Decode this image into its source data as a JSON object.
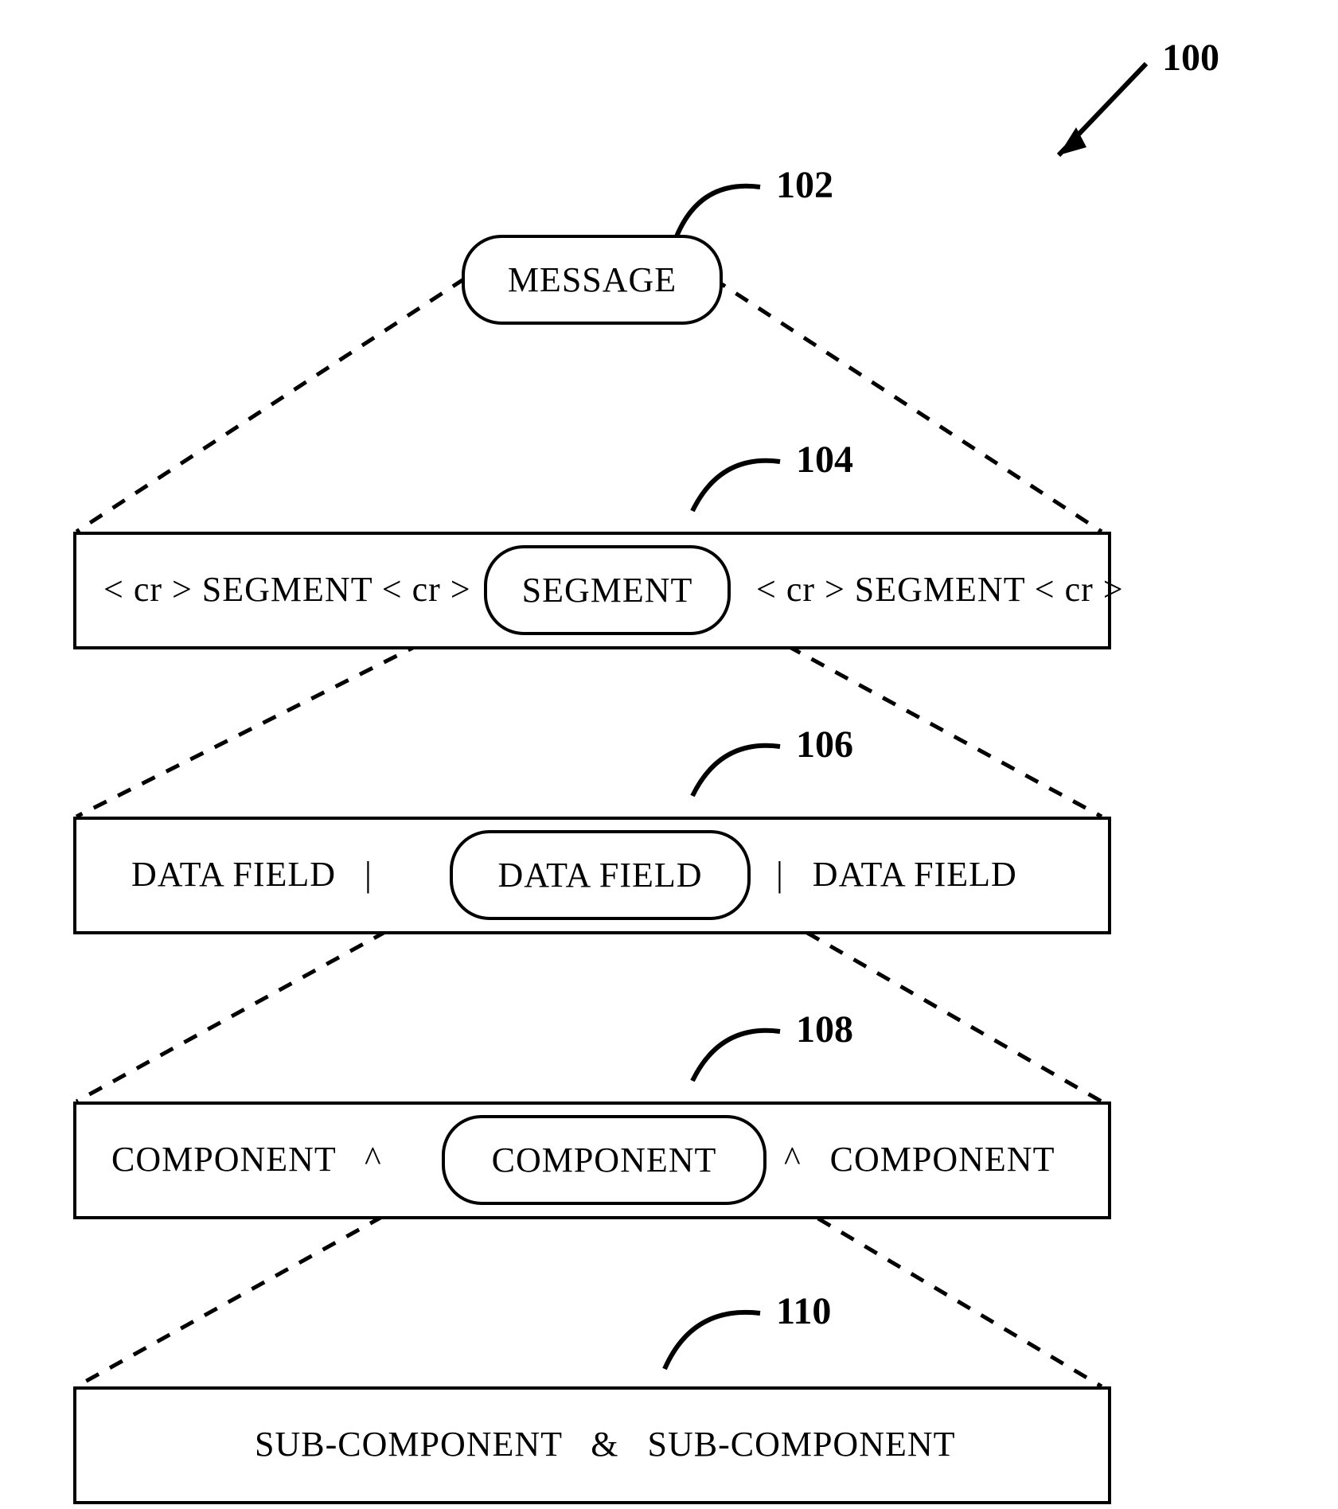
{
  "refs": {
    "r100": "100",
    "r102": "102",
    "r104": "104",
    "r106": "106",
    "r108": "108",
    "r110": "110"
  },
  "level1": {
    "pill": "MESSAGE"
  },
  "level2": {
    "left": "< cr > SEGMENT < cr >",
    "pill": "SEGMENT",
    "right": "< cr > SEGMENT < cr >"
  },
  "level3": {
    "left": "DATA FIELD   |",
    "pill": "DATA FIELD",
    "right": "|   DATA FIELD"
  },
  "level4": {
    "left": "COMPONENT   ^",
    "pill": "COMPONENT",
    "right": "^   COMPONENT"
  },
  "level5": {
    "text": "SUB-COMPONENT   &   SUB-COMPONENT"
  }
}
